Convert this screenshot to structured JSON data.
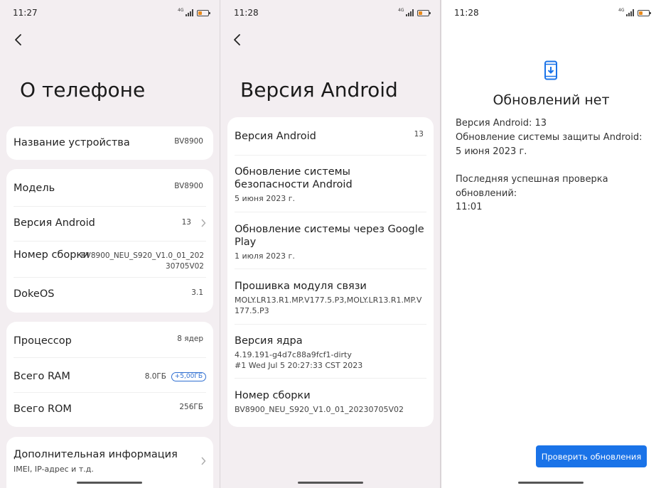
{
  "colors": {
    "panel_bg": "#f3eef1",
    "card_bg": "#ffffff",
    "accent": "#1a73e8",
    "battery": "#e98a1b",
    "badge": "#2f6fd1"
  },
  "panel1": {
    "time": "11:27",
    "network": "4G",
    "title": "О телефоне",
    "device_name": {
      "label": "Название устройства",
      "value": "BV8900"
    },
    "model": {
      "label": "Модель",
      "value": "BV8900"
    },
    "android_version": {
      "label": "Версия Android",
      "value": "13"
    },
    "build_number": {
      "label": "Номер сборки",
      "value_line1": "BV8900_NEU_S920_V1.0_01_202",
      "value_line2": "30705V02"
    },
    "os": {
      "label": "DokeOS",
      "value": "3.1"
    },
    "processor": {
      "label": "Процессор",
      "value": "8 ядер"
    },
    "ram": {
      "label": "Всего RAM",
      "value": "8.0ГБ",
      "extra": "+5,00ГБ"
    },
    "rom": {
      "label": "Всего ROM",
      "value": "256ГБ"
    },
    "more_info": {
      "label": "Дополнительная информация",
      "sub": "IMEI, IP-адрес и т.д."
    }
  },
  "panel2": {
    "time": "11:28",
    "network": "4G",
    "title": "Версия Android",
    "items": [
      {
        "title": "Версия Android",
        "value": "13"
      },
      {
        "title": "Обновление системы безопасности Android",
        "sub": "5 июня 2023 г."
      },
      {
        "title": "Обновление системы через Google Play",
        "sub": "1 июля 2023 г."
      },
      {
        "title": "Прошивка модуля связи",
        "sub": "MOLY.LR13.R1.MP.V177.5.P3,MOLY.LR13.R1.MP.V177.5.P3"
      },
      {
        "title": "Версия ядра",
        "sub": "4.19.191-g4d7c88a9fcf1-dirty",
        "sub2": "#1 Wed Jul 5 20:27:33 CST 2023"
      },
      {
        "title": "Номер сборки",
        "sub": "BV8900_NEU_S920_V1.0_01_20230705V02"
      }
    ]
  },
  "panel3": {
    "time": "11:28",
    "network": "4G",
    "title": "Обновлений нет",
    "android_version": "Версия Android: 13",
    "security_update": "Обновление системы защиты Android: 5 июня 2023 г.",
    "last_check_label": "Последняя успешная проверка обновлений:",
    "last_check_time": "11:01",
    "check_button": "Проверить обновления"
  }
}
